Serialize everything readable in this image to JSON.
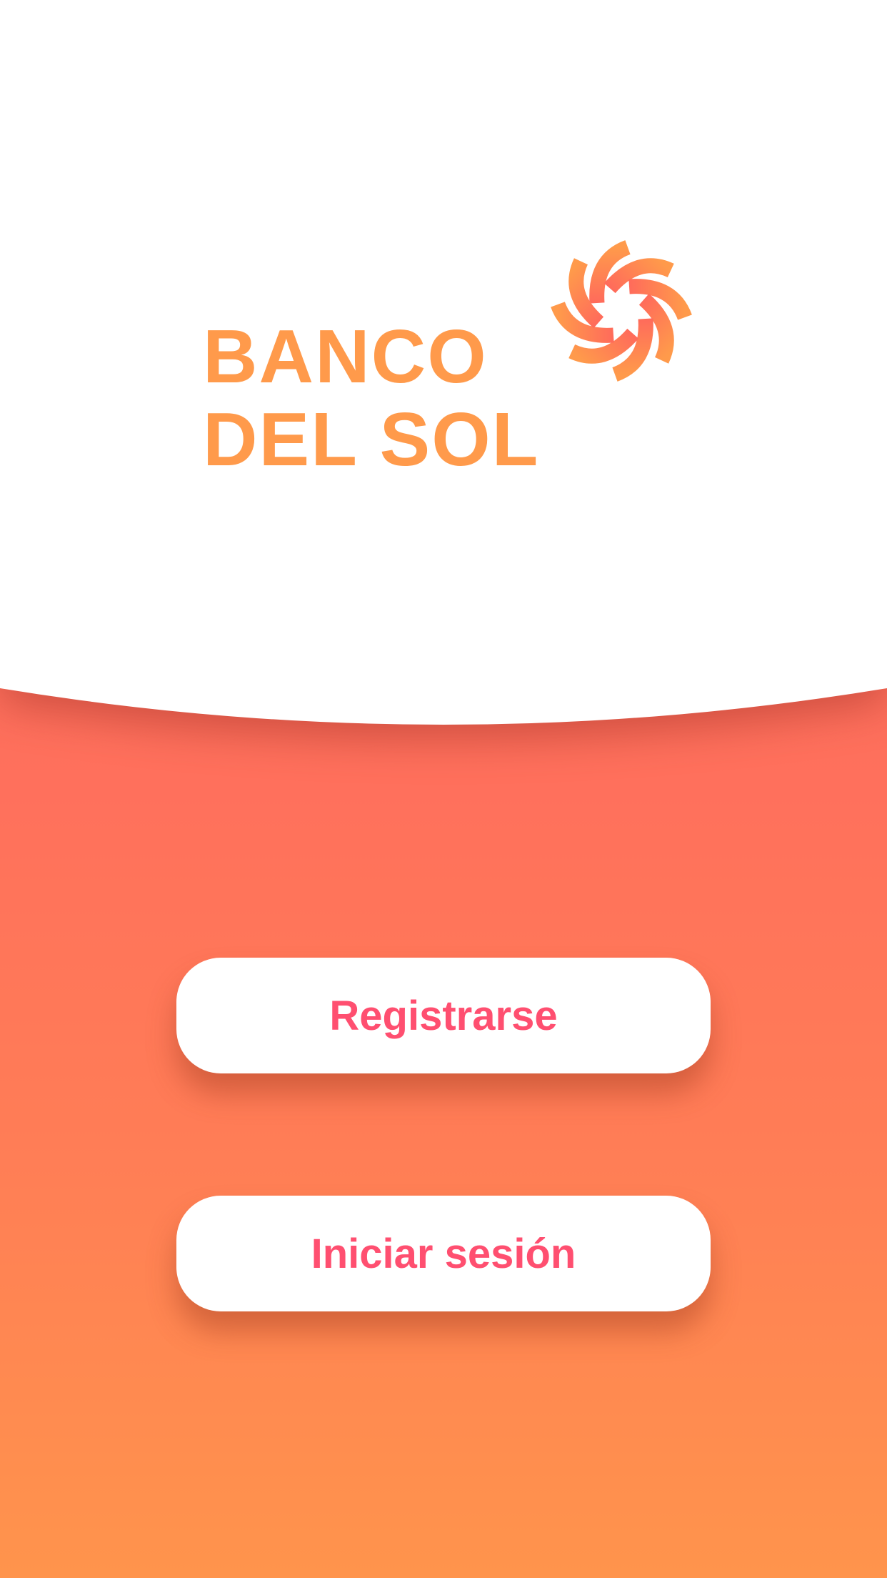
{
  "brand": {
    "name_line1": "BANCO",
    "name_line2": "DEL SOL",
    "logo_icon": "sun-icon",
    "color": "#ff9a4b"
  },
  "actions": {
    "register_label": "Registrarse",
    "login_label": "Iniciar sesión",
    "text_color": "#ff4f70"
  }
}
